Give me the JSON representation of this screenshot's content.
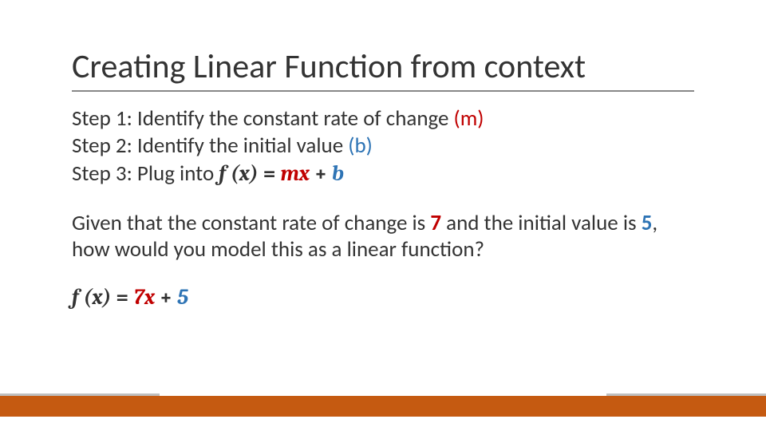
{
  "title": "Creating Linear Function from context",
  "steps": {
    "s1_lead": "Step 1: Identify the constant rate of change ",
    "s1_m": "(m)",
    "s2_lead": "Step 2: Identify the initial value ",
    "s2_b": "(b)",
    "s3_lead": "Step 3: Plug into ",
    "s3_fx": "f (x)",
    "s3_eq": " = ",
    "s3_mx": "mx",
    "s3_plus": " + ",
    "s3_b": "b"
  },
  "question": {
    "q_a": "Given that the constant rate of change is ",
    "q_7": "7",
    "q_b": " and the initial value is ",
    "q_5": "5",
    "q_c": ", how would you model this as a linear function?"
  },
  "answer": {
    "fx": "f (x)",
    "eq": " = ",
    "mx": "7x",
    "plus": " + ",
    "b": "5"
  }
}
